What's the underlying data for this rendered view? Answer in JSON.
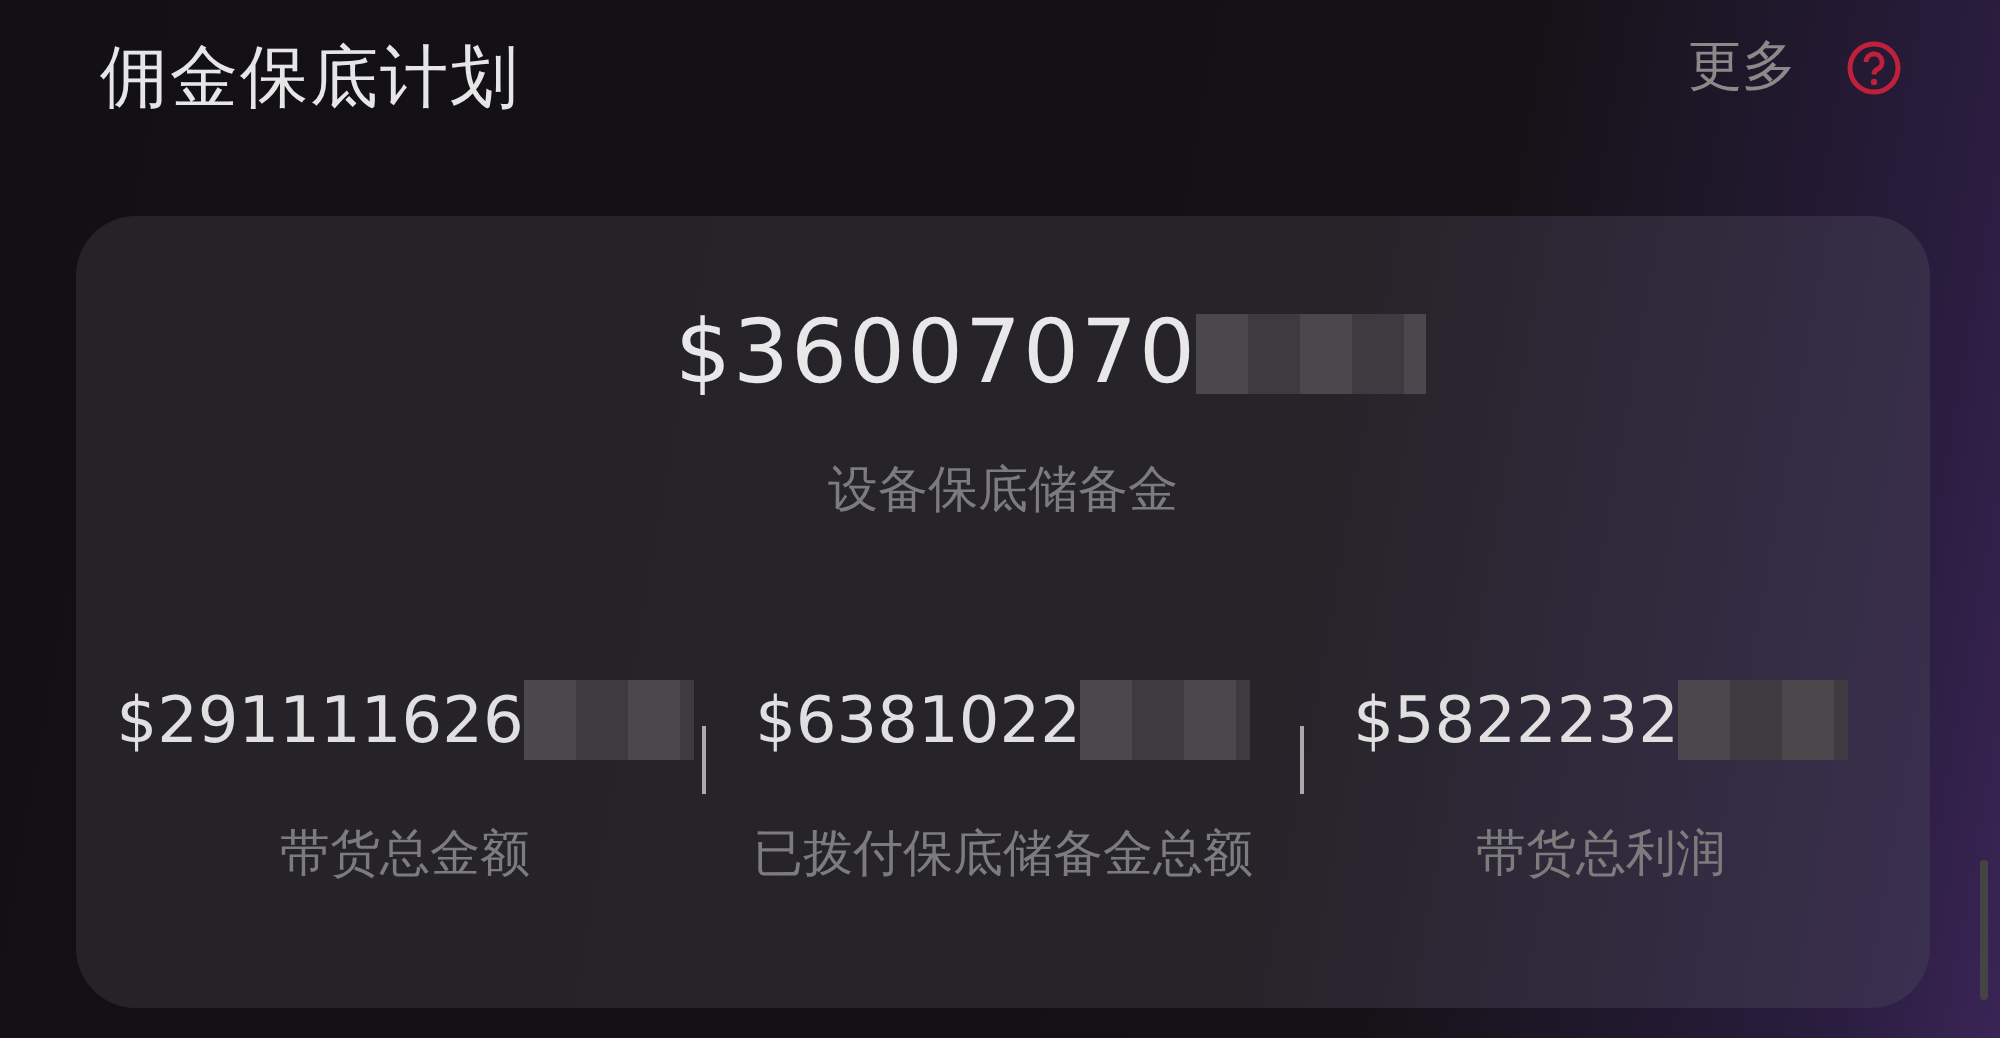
{
  "header": {
    "title": "佣金保底计划",
    "more_link": "更多"
  },
  "reserve": {
    "amount": "$36007070",
    "label": "设备保底储备金"
  },
  "stats": [
    {
      "amount": "$291111626",
      "label": "带货总金额"
    },
    {
      "amount": "$6381022",
      "label": "已拨付保底储备金总额"
    },
    {
      "amount": "$5822232",
      "label": "带货总利润"
    }
  ]
}
